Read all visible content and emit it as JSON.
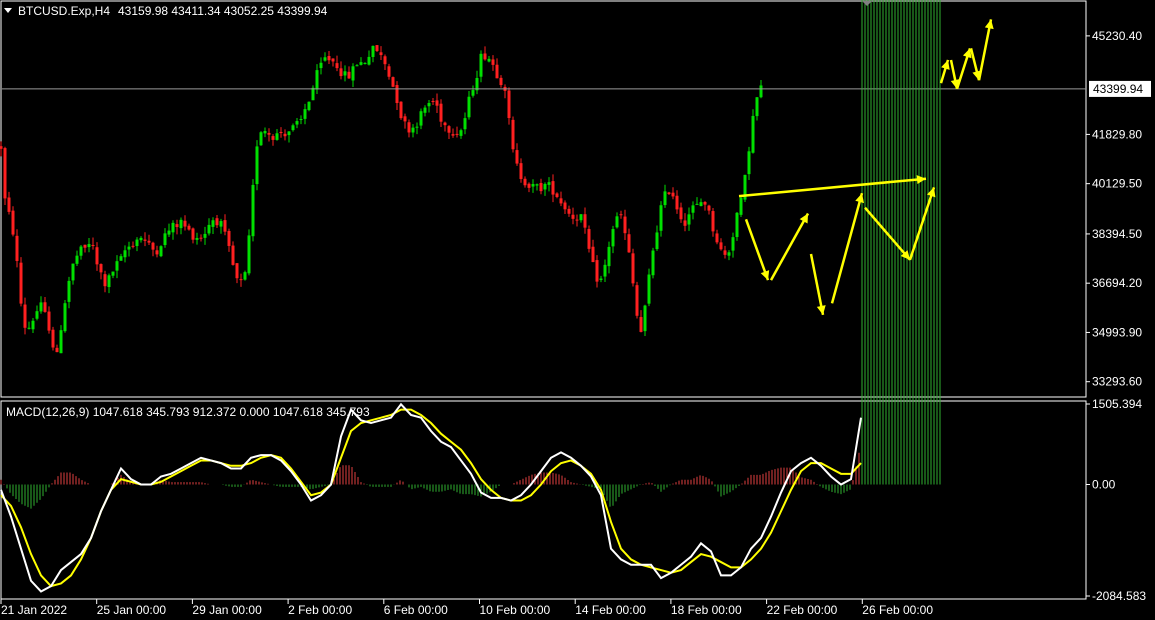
{
  "colors": {
    "background": "#000000",
    "bull": "#00e000",
    "bear": "#ff2020",
    "macd_line": "#ffffff",
    "signal_line": "#ffff00",
    "annotation": "#ffff00",
    "grid_border": "#ffffff",
    "price_line": "#9a9a9a"
  },
  "header": {
    "symbol": "BTCUSD.Exp,H4",
    "ohlc": "43159.98 43411.34 43052.25 43399.94"
  },
  "macd_header": {
    "label": "MACD(12,26,9) 1047.618 345.793 912.372 0.000 1047.618 345.793"
  },
  "price_axis": {
    "ticks": [
      "45230.40",
      "41829.80",
      "40129.50",
      "38394.50",
      "36694.20",
      "34993.90",
      "33293.60"
    ],
    "current_price": "43399.94"
  },
  "macd_axis": {
    "ticks": [
      "1505.394",
      "0.00",
      "-2084.583"
    ]
  },
  "time_axis": {
    "ticks": [
      "21 Jan 2022",
      "25 Jan 00:00",
      "29 Jan 00:00",
      "2 Feb 00:00",
      "6 Feb 00:00",
      "10 Feb 00:00",
      "14 Feb 00:00",
      "18 Feb 00:00",
      "22 Feb 00:00",
      "26 Feb 00:00"
    ]
  },
  "chart_data": [
    {
      "type": "candlestick",
      "timeframe": "H4",
      "ylim": [
        32800,
        46400
      ],
      "close_path": {
        "x_bars": [
          0,
          5,
          10,
          15,
          20,
          25,
          30,
          35,
          40,
          45,
          50,
          55,
          60,
          65,
          70,
          75,
          80,
          85,
          90,
          95,
          100,
          105,
          110,
          115,
          120,
          125,
          130,
          135,
          140,
          145,
          150,
          155,
          160,
          165,
          170,
          175,
          180,
          185,
          190,
          195,
          200,
          205,
          210,
          215,
          220,
          225,
          230,
          235,
          240,
          245,
          250,
          255,
          260,
          265,
          270,
          275,
          280,
          285,
          290,
          295,
          300,
          305,
          310,
          315,
          320,
          325,
          330,
          335,
          340,
          345,
          350,
          355,
          360,
          365,
          370,
          375,
          380,
          385,
          390,
          395,
          400,
          405,
          410,
          415,
          420,
          425,
          430,
          435,
          440,
          445,
          450,
          455,
          460,
          465,
          470,
          475,
          480,
          485,
          490,
          495,
          500,
          505,
          510,
          515,
          520,
          525,
          530,
          535,
          540,
          545,
          550,
          555,
          560,
          565,
          570,
          575,
          580,
          585,
          590,
          595,
          600,
          605,
          610,
          615,
          620,
          625,
          630,
          635,
          640,
          645,
          650,
          655,
          660,
          665,
          670,
          675,
          680,
          685,
          690,
          695,
          700,
          705,
          710,
          715,
          720,
          725,
          730,
          735,
          740,
          745,
          750,
          755,
          760,
          765,
          770,
          775,
          780,
          785,
          790,
          795,
          800,
          805,
          810,
          815,
          820,
          825,
          830,
          835,
          840,
          845,
          850,
          855,
          860,
          865,
          870,
          875,
          880,
          885,
          890,
          895,
          900,
          905,
          910,
          915,
          920,
          925,
          930,
          935,
          940
        ],
        "close": [
          41400,
          39100,
          39000,
          37700,
          36000,
          35000,
          35300,
          35700,
          35900,
          35500,
          35000,
          33900,
          35200,
          36300,
          37100,
          37600,
          37800,
          37900,
          38200,
          37400,
          37000,
          36600,
          37000,
          37300,
          37500,
          37900,
          38000,
          38200,
          38300,
          38100,
          37900,
          37800,
          38100,
          38400,
          38600,
          38700,
          38800,
          38600,
          38400,
          38300,
          38300,
          38500,
          38900,
          38900,
          38700,
          38200,
          37600,
          36800,
          36700,
          37000,
          39000,
          41400,
          42000,
          42000,
          41800,
          41800,
          41900,
          41900,
          42000,
          42100,
          42300,
          42800,
          43200,
          43800,
          44200,
          44500,
          44400,
          44300,
          44000,
          43800,
          43900,
          44300,
          44300,
          44400,
          44700,
          44800,
          44500,
          44200,
          43700,
          43200,
          42500,
          42100,
          42000,
          42200,
          42500,
          42800,
          43000,
          42900,
          42400,
          42100,
          42000,
          41900,
          42000,
          42500,
          43300,
          43800,
          44500,
          44600,
          44400,
          44000,
          43700,
          43400,
          41500,
          40800,
          40400,
          40200,
          40000,
          40000,
          40000,
          40100,
          40000,
          39800,
          39500,
          39300,
          39000,
          39000,
          39000,
          38300,
          37500,
          36900,
          36800,
          37400,
          38400,
          38900,
          39000,
          38200,
          37300,
          35700,
          35000,
          36000,
          37500,
          38400,
          39300,
          39800,
          40000,
          39400,
          39000,
          38800,
          39300,
          39300,
          39500,
          39500,
          38800,
          38300,
          37800,
          37600,
          38000,
          39000,
          39500,
          40500,
          42000,
          43000,
          43400
        ]
      },
      "annotations": {
        "arrows": [
          {
            "from": [
              745,
              38900
            ],
            "to": [
              767,
              36800
            ]
          },
          {
            "from": [
              770,
              36800
            ],
            "to": [
              807,
              39100
            ]
          },
          {
            "from": [
              810,
              37700
            ],
            "to": [
              822,
              35600
            ]
          },
          {
            "from": [
              831,
              36000
            ],
            "to": [
              861,
              39800
            ]
          },
          {
            "from": [
              864,
              39300
            ],
            "to": [
              909,
              37500
            ]
          },
          {
            "from": [
              909,
              37500
            ],
            "to": [
              933,
              40000
            ]
          },
          {
            "from": [
              738,
              39700
            ],
            "to": [
              925,
              40300
            ]
          },
          {
            "from": [
              940,
              43600
            ],
            "to": [
              947,
              44400
            ]
          },
          {
            "from": [
              950,
              44400
            ],
            "to": [
              956,
              43400
            ]
          },
          {
            "from": [
              956,
              43400
            ],
            "to": [
              969,
              44800
            ]
          },
          {
            "from": [
              970,
              44800
            ],
            "to": [
              978,
              43700
            ]
          },
          {
            "from": [
              978,
              43700
            ],
            "to": [
              990,
              45800
            ]
          }
        ]
      }
    },
    {
      "type": "macd",
      "ylim": [
        -2084.583,
        1505.394
      ],
      "macd_line": {
        "x": [
          0,
          10,
          20,
          30,
          40,
          50,
          60,
          70,
          80,
          90,
          100,
          110,
          120,
          130,
          140,
          150,
          160,
          170,
          180,
          190,
          200,
          210,
          220,
          230,
          240,
          250,
          260,
          270,
          280,
          290,
          300,
          310,
          320,
          330,
          340,
          350,
          360,
          370,
          380,
          390,
          400,
          410,
          420,
          430,
          440,
          450,
          460,
          470,
          480,
          490,
          500,
          510,
          520,
          530,
          540,
          550,
          560,
          570,
          580,
          590,
          600,
          610,
          620,
          630,
          640,
          650,
          660,
          670,
          680,
          690,
          700,
          710,
          720,
          730,
          740,
          750,
          760,
          770,
          780,
          790,
          800,
          810,
          820,
          830,
          840,
          850,
          860,
          870,
          880,
          890,
          900,
          910,
          920,
          930,
          940
        ],
        "y": [
          -100,
          -600,
          -1200,
          -1800,
          -2000,
          -1900,
          -1600,
          -1450,
          -1300,
          -1000,
          -500,
          -100,
          300,
          100,
          0,
          0,
          150,
          200,
          300,
          400,
          500,
          450,
          400,
          300,
          300,
          500,
          550,
          550,
          450,
          250,
          0,
          -300,
          -200,
          0,
          900,
          1400,
          1200,
          1150,
          1200,
          1250,
          1500,
          1300,
          1250,
          1000,
          800,
          700,
          450,
          200,
          -150,
          -250,
          -250,
          -300,
          -200,
          0,
          250,
          500,
          600,
          500,
          350,
          150,
          -200,
          -1200,
          -1400,
          -1500,
          -1500,
          -1500,
          -1750,
          -1650,
          -1500,
          -1350,
          -1100,
          -1250,
          -1700,
          -1700,
          -1550,
          -1200,
          -1000,
          -600,
          -150,
          250,
          400,
          500,
          350,
          150,
          0,
          100,
          1250
        ]
      },
      "signal_line": {
        "x": [
          0,
          10,
          20,
          30,
          40,
          50,
          60,
          70,
          80,
          90,
          100,
          110,
          120,
          130,
          140,
          150,
          160,
          170,
          180,
          190,
          200,
          210,
          220,
          230,
          240,
          250,
          260,
          270,
          280,
          290,
          300,
          310,
          320,
          330,
          340,
          350,
          360,
          370,
          380,
          390,
          400,
          410,
          420,
          430,
          440,
          450,
          460,
          470,
          480,
          490,
          500,
          510,
          520,
          530,
          540,
          550,
          560,
          570,
          580,
          590,
          600,
          610,
          620,
          630,
          640,
          650,
          660,
          670,
          680,
          690,
          700,
          710,
          720,
          730,
          740,
          750,
          760,
          770,
          780,
          790,
          800,
          810,
          820,
          830,
          840,
          850,
          860,
          870,
          880,
          890,
          900,
          910,
          920,
          930,
          940
        ],
        "y": [
          -200,
          -400,
          -800,
          -1300,
          -1700,
          -1900,
          -1850,
          -1700,
          -1400,
          -1000,
          -500,
          -100,
          100,
          50,
          0,
          0,
          50,
          150,
          250,
          350,
          450,
          450,
          400,
          350,
          350,
          400,
          500,
          550,
          500,
          300,
          50,
          -200,
          -150,
          0,
          500,
          1000,
          1150,
          1200,
          1250,
          1300,
          1400,
          1400,
          1300,
          1150,
          950,
          800,
          650,
          400,
          100,
          -100,
          -250,
          -300,
          -300,
          -200,
          0,
          250,
          400,
          450,
          350,
          200,
          -100,
          -700,
          -1200,
          -1400,
          -1500,
          -1550,
          -1600,
          -1650,
          -1600,
          -1450,
          -1300,
          -1350,
          -1450,
          -1550,
          -1550,
          -1400,
          -1200,
          -900,
          -500,
          -100,
          250,
          400,
          400,
          300,
          200,
          200,
          400
        ]
      }
    }
  ]
}
